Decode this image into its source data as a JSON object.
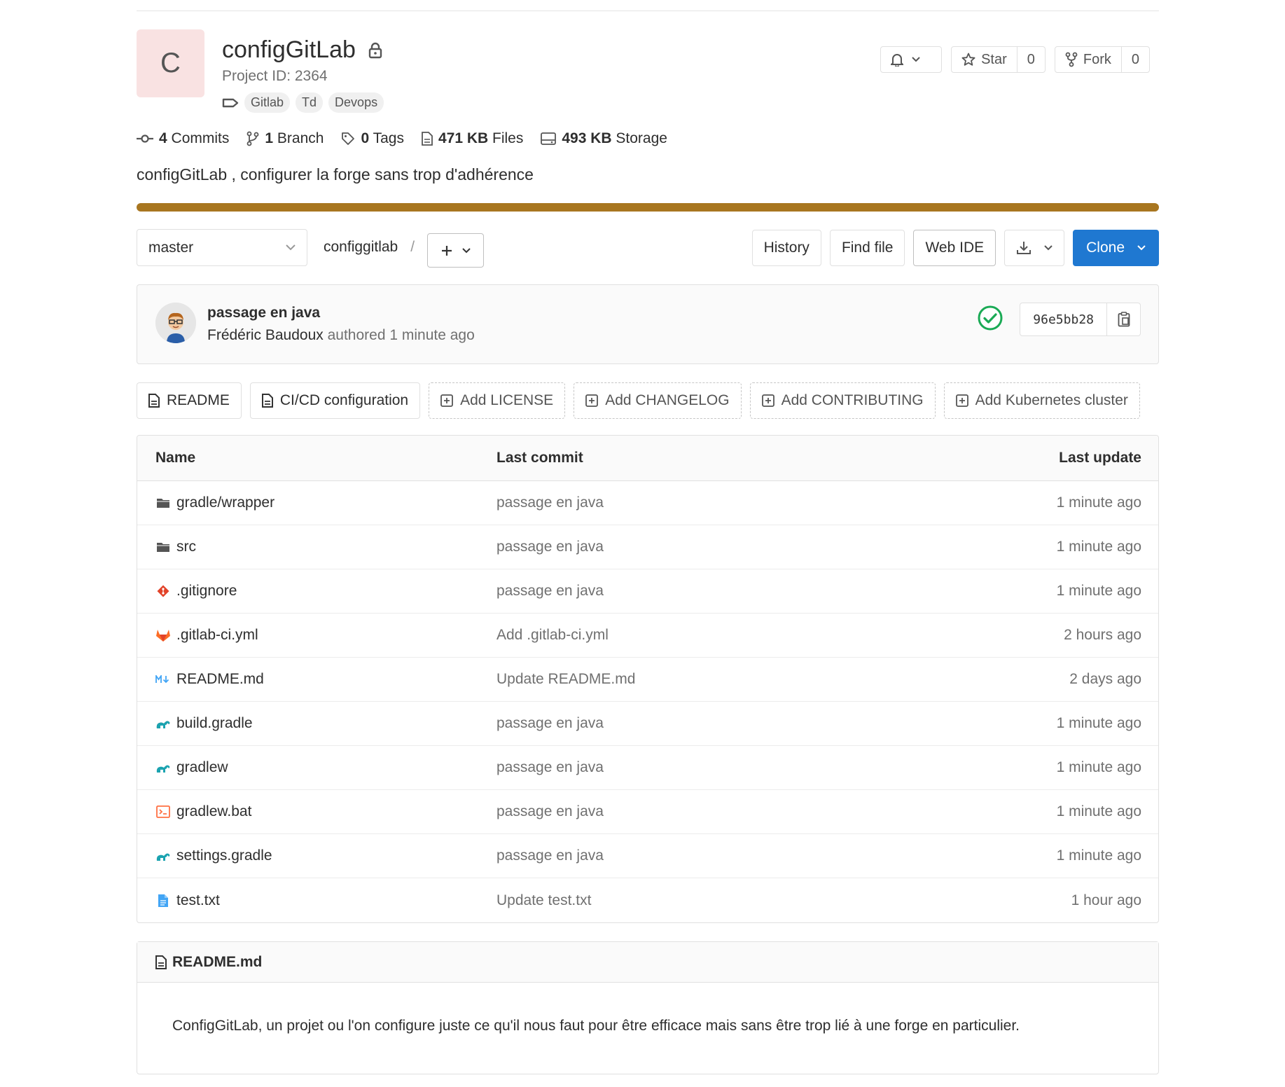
{
  "project": {
    "avatar_letter": "C",
    "name": "configGitLab",
    "project_id": "Project ID: 2364",
    "topics": [
      "Gitlab",
      "Td",
      "Devops"
    ]
  },
  "header_actions": {
    "star_label": "Star",
    "star_count": "0",
    "fork_label": "Fork",
    "fork_count": "0"
  },
  "stats": {
    "commits_num": "4",
    "commits_label": "Commits",
    "branch_num": "1",
    "branch_label": "Branch",
    "tags_num": "0",
    "tags_label": "Tags",
    "files_num": "471 KB",
    "files_label": "Files",
    "storage_num": "493 KB",
    "storage_label": "Storage"
  },
  "description": "configGitLab , configurer la forge sans trop d'adhérence",
  "accent_color": "#a87620",
  "tree_controls": {
    "branch": "master",
    "path_root": "configgitlab",
    "path_sep": "/",
    "history": "History",
    "find_file": "Find file",
    "web_ide": "Web IDE",
    "clone": "Clone"
  },
  "last_commit": {
    "title": "passage en java",
    "author": "Frédéric Baudoux",
    "authored": "authored",
    "time": "1 minute ago",
    "sha": "96e5bb28",
    "pipeline_status": "passed"
  },
  "quick_links": [
    {
      "label": "README",
      "icon": "file-icon",
      "style": "solid"
    },
    {
      "label": "CI/CD configuration",
      "icon": "file-icon",
      "style": "solid"
    },
    {
      "label": "Add LICENSE",
      "icon": "plus-square-icon",
      "style": "dashed"
    },
    {
      "label": "Add CHANGELOG",
      "icon": "plus-square-icon",
      "style": "dashed"
    },
    {
      "label": "Add CONTRIBUTING",
      "icon": "plus-square-icon",
      "style": "dashed"
    },
    {
      "label": "Add Kubernetes cluster",
      "icon": "plus-square-icon",
      "style": "dashed"
    }
  ],
  "file_table": {
    "headers": {
      "name": "Name",
      "last_commit": "Last commit",
      "last_update": "Last update"
    },
    "rows": [
      {
        "name": "gradle/wrapper",
        "icon": "folder-icon",
        "commit": "passage en java",
        "date": "1 minute ago"
      },
      {
        "name": "src",
        "icon": "folder-icon",
        "commit": "passage en java",
        "date": "1 minute ago"
      },
      {
        "name": ".gitignore",
        "icon": "git-icon",
        "commit": "passage en java",
        "date": "1 minute ago"
      },
      {
        "name": ".gitlab-ci.yml",
        "icon": "gitlab-icon",
        "commit": "Add .gitlab-ci.yml",
        "date": "2 hours ago"
      },
      {
        "name": "README.md",
        "icon": "markdown-icon",
        "commit": "Update README.md",
        "date": "2 days ago"
      },
      {
        "name": "build.gradle",
        "icon": "gradle-icon",
        "commit": "passage en java",
        "date": "1 minute ago"
      },
      {
        "name": "gradlew",
        "icon": "gradle-icon",
        "commit": "passage en java",
        "date": "1 minute ago"
      },
      {
        "name": "gradlew.bat",
        "icon": "console-icon",
        "commit": "passage en java",
        "date": "1 minute ago"
      },
      {
        "name": "settings.gradle",
        "icon": "gradle-icon",
        "commit": "passage en java",
        "date": "1 minute ago"
      },
      {
        "name": "test.txt",
        "icon": "text-file-icon",
        "commit": "Update test.txt",
        "date": "1 hour ago"
      }
    ]
  },
  "readme": {
    "title": "README.md",
    "body": "ConfigGitLab, un projet ou l'on configure juste ce qu'il nous faut pour être efficace mais sans être trop lié à une forge en particulier."
  }
}
